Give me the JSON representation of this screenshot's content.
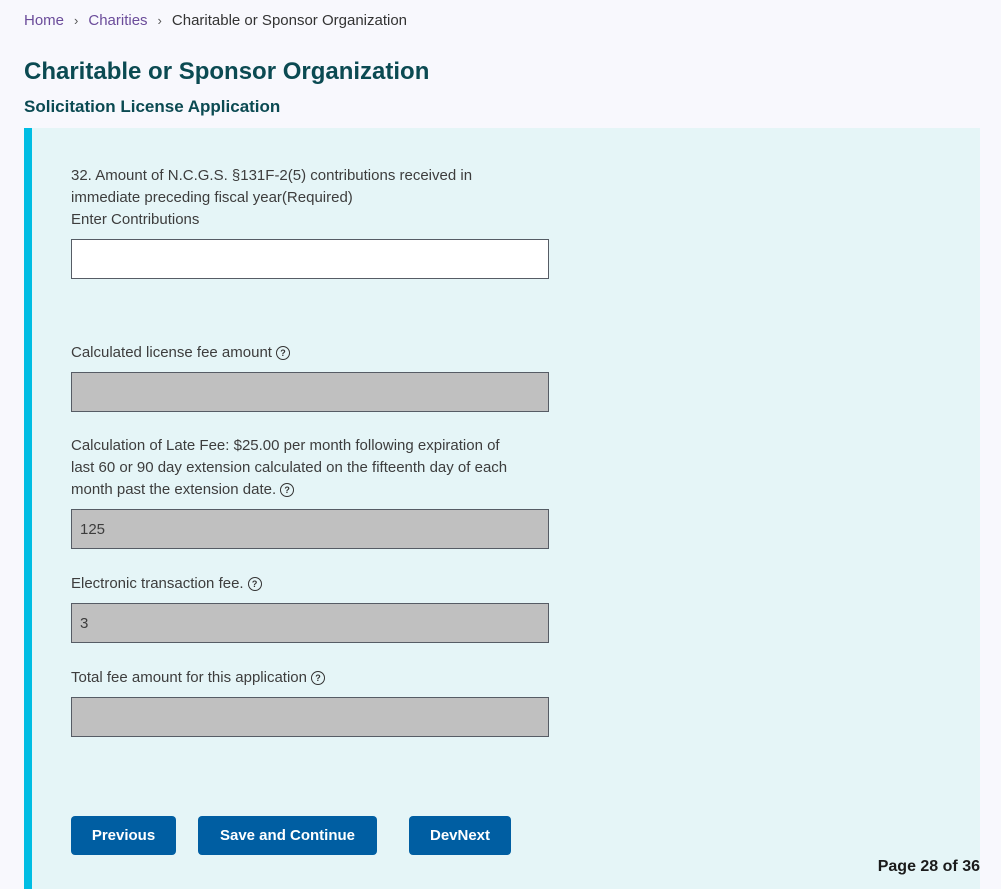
{
  "breadcrumb": {
    "items": [
      {
        "label": "Home"
      },
      {
        "label": "Charities"
      },
      {
        "label": "Charitable or Sponsor Organization"
      }
    ],
    "separator": "›"
  },
  "header": {
    "title": "Charitable or Sponsor Organization",
    "subtitle": "Solicitation License Application"
  },
  "form": {
    "contributions": {
      "label_line1": "32. Amount of N.C.G.S. §131F-2(5) contributions received in",
      "label_line2": "immediate preceding fiscal year(Required)",
      "label_line3": "Enter Contributions",
      "value": "",
      "placeholder": ""
    },
    "license_fee": {
      "label": "Calculated license fee amount",
      "value": ""
    },
    "late_fee": {
      "label_line1": "Calculation of Late Fee: $25.00 per month following expiration of",
      "label_line2": "last 60 or 90 day extension calculated on the fifteenth day of each",
      "label_line3": "month past the extension date.",
      "value": "125"
    },
    "transaction_fee": {
      "label": "Electronic transaction fee.",
      "value": "3"
    },
    "total_fee": {
      "label": "Total fee amount for this application",
      "value": ""
    },
    "help_icon_glyph": "?"
  },
  "buttons": {
    "previous": "Previous",
    "save_continue": "Save and Continue",
    "dev_next": "DevNext"
  },
  "pagination": {
    "text": "Page 28 of 36",
    "current": 28,
    "total": 36
  },
  "colors": {
    "primary_button": "#005ea2",
    "panel_background": "#e5f5f7",
    "panel_accent": "#00bde3",
    "heading": "#0b4a52",
    "link": "#6b4c9a",
    "readonly_input": "#c0c0c0"
  }
}
